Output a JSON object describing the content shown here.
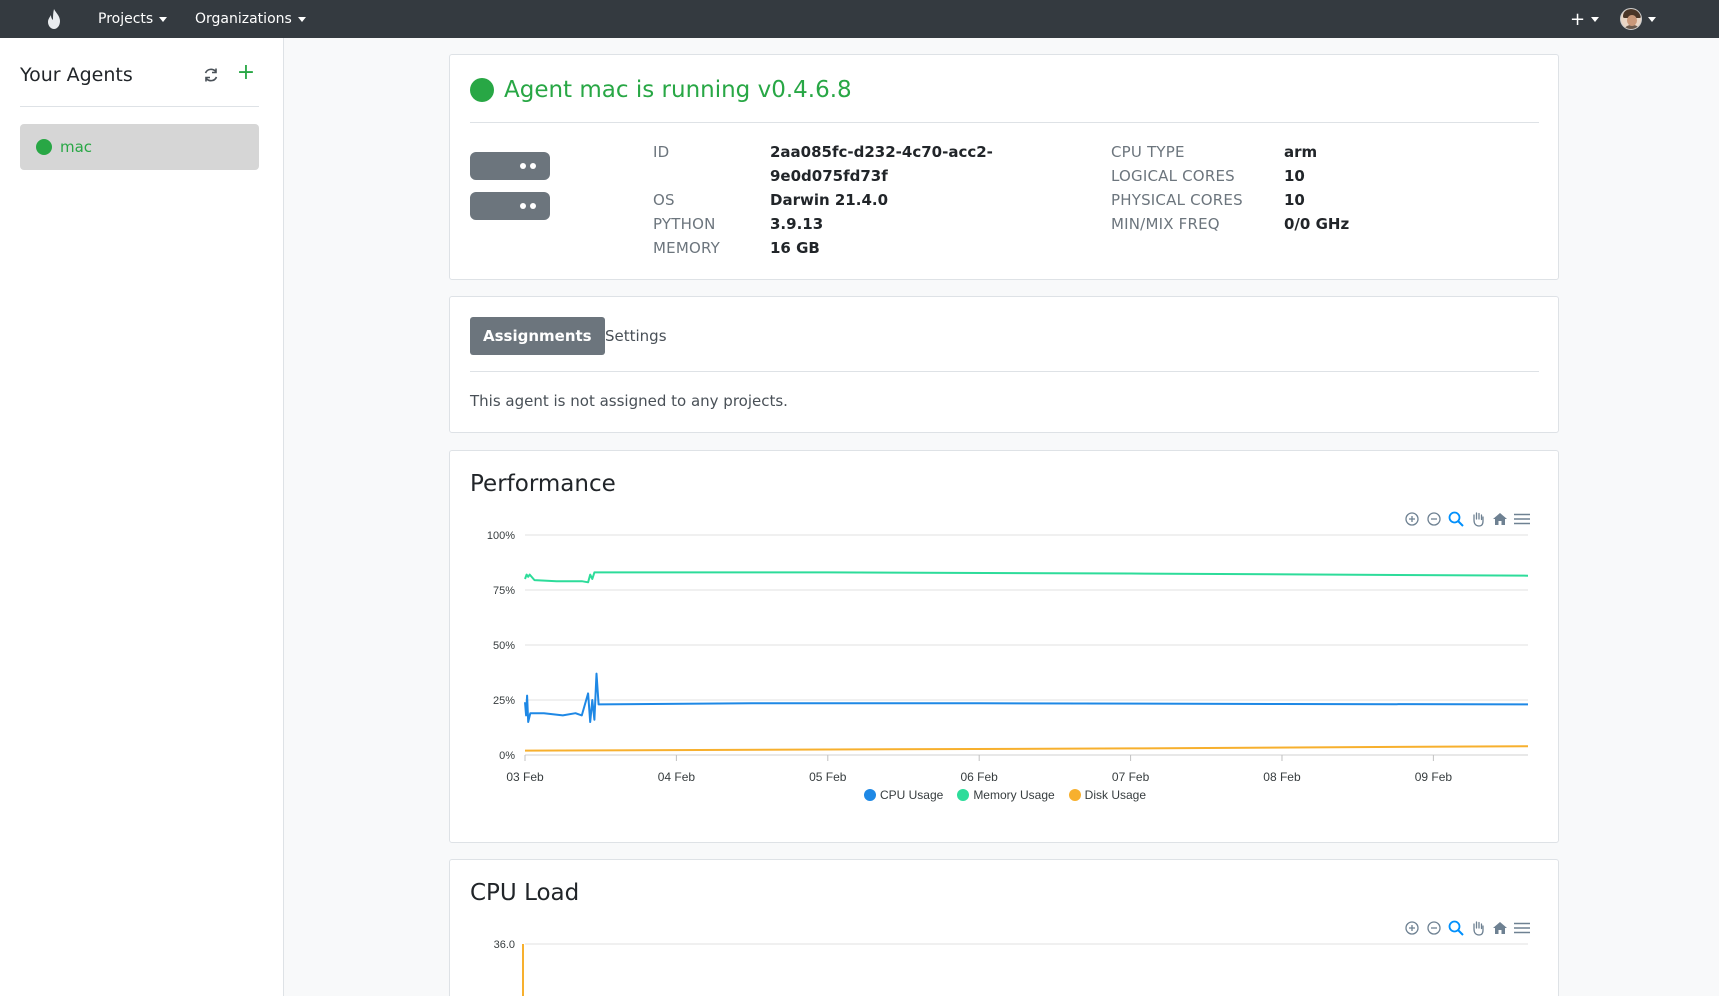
{
  "navbar": {
    "projects_label": "Projects",
    "organizations_label": "Organizations",
    "add_label": "+"
  },
  "sidebar": {
    "title": "Your Agents",
    "agents": [
      {
        "label": "mac",
        "status_color": "#28a745"
      }
    ]
  },
  "agent": {
    "status_title": "Agent mac is running v0.4.6.8",
    "info_left": [
      {
        "label": "ID",
        "value": "2aa085fc-d232-4c70-acc2-",
        "value2": "9e0d075fd73f"
      },
      {
        "label": "OS",
        "value": "Darwin 21.4.0"
      },
      {
        "label": "PYTHON",
        "value": "3.9.13"
      },
      {
        "label": "MEMORY",
        "value": "16 GB"
      }
    ],
    "info_right": [
      {
        "label": "CPU TYPE",
        "value": "arm"
      },
      {
        "label": "LOGICAL CORES",
        "value": "10"
      },
      {
        "label": "PHYSICAL CORES",
        "value": "10"
      },
      {
        "label": "MIN/MIX FREQ",
        "value": "0/0 GHz"
      }
    ]
  },
  "tabs": {
    "assignments": "Assignments",
    "settings": "Settings",
    "message": "This agent is not assigned to any projects."
  },
  "performance": {
    "heading": "Performance"
  },
  "cpu_load": {
    "heading": "CPU Load"
  },
  "colors": {
    "accent": "#28a745",
    "cpu": "#1e88e5",
    "memory": "#2ddc9a",
    "disk": "#f7b02e"
  },
  "chart_data": [
    {
      "type": "line",
      "title": "Performance",
      "x_ticks": [
        "03 Feb",
        "04 Feb",
        "05 Feb",
        "06 Feb",
        "07 Feb",
        "08 Feb",
        "09 Feb"
      ],
      "y_ticks": [
        "100%",
        "75%",
        "50%",
        "25%",
        "0%"
      ],
      "ylim": [
        0,
        100
      ],
      "xlim": [
        "2023-02-03T00:00",
        "2023-02-09T15:00"
      ],
      "grid": true,
      "legend_position": "bottom",
      "series": [
        {
          "name": "CPU Usage",
          "color": "#1e88e5",
          "points": [
            [
              "2023-02-03T00:00",
              24
            ],
            [
              "2023-02-03T00:10",
              18
            ],
            [
              "2023-02-03T00:20",
              27
            ],
            [
              "2023-02-03T00:30",
              15
            ],
            [
              "2023-02-03T00:50",
              19
            ],
            [
              "2023-02-03T03:00",
              19
            ],
            [
              "2023-02-03T06:00",
              18
            ],
            [
              "2023-02-03T08:00",
              19
            ],
            [
              "2023-02-03T09:00",
              18
            ],
            [
              "2023-02-03T10:00",
              28
            ],
            [
              "2023-02-03T10:20",
              15
            ],
            [
              "2023-02-03T10:40",
              25
            ],
            [
              "2023-02-03T11:00",
              16
            ],
            [
              "2023-02-03T11:20",
              37
            ],
            [
              "2023-02-03T11:40",
              23
            ],
            [
              "2023-02-04T12:00",
              23.5
            ],
            [
              "2023-02-06T00:00",
              23.5
            ],
            [
              "2023-02-08T00:00",
              23.2
            ],
            [
              "2023-02-09T15:00",
              23
            ]
          ]
        },
        {
          "name": "Memory Usage",
          "color": "#2ddc9a",
          "points": [
            [
              "2023-02-03T00:00",
              80
            ],
            [
              "2023-02-03T00:15",
              82
            ],
            [
              "2023-02-03T00:30",
              81
            ],
            [
              "2023-02-03T00:45",
              82
            ],
            [
              "2023-02-03T01:30",
              79.5
            ],
            [
              "2023-02-03T05:00",
              79
            ],
            [
              "2023-02-03T09:00",
              79
            ],
            [
              "2023-02-03T10:00",
              78.5
            ],
            [
              "2023-02-03T10:20",
              82
            ],
            [
              "2023-02-03T10:40",
              80
            ],
            [
              "2023-02-03T11:00",
              83
            ],
            [
              "2023-02-03T11:30",
              83
            ],
            [
              "2023-02-05T00:00",
              83
            ],
            [
              "2023-02-07T00:00",
              82.5
            ],
            [
              "2023-02-09T15:00",
              81.5
            ]
          ]
        },
        {
          "name": "Disk Usage",
          "color": "#f7b02e",
          "points": [
            [
              "2023-02-03T00:00",
              2
            ],
            [
              "2023-02-05T00:00",
              2.5
            ],
            [
              "2023-02-07T00:00",
              3
            ],
            [
              "2023-02-09T15:00",
              4
            ]
          ]
        }
      ]
    },
    {
      "type": "line",
      "title": "CPU Load",
      "y_ticks": [
        "36.0"
      ],
      "grid": true,
      "series": []
    }
  ]
}
